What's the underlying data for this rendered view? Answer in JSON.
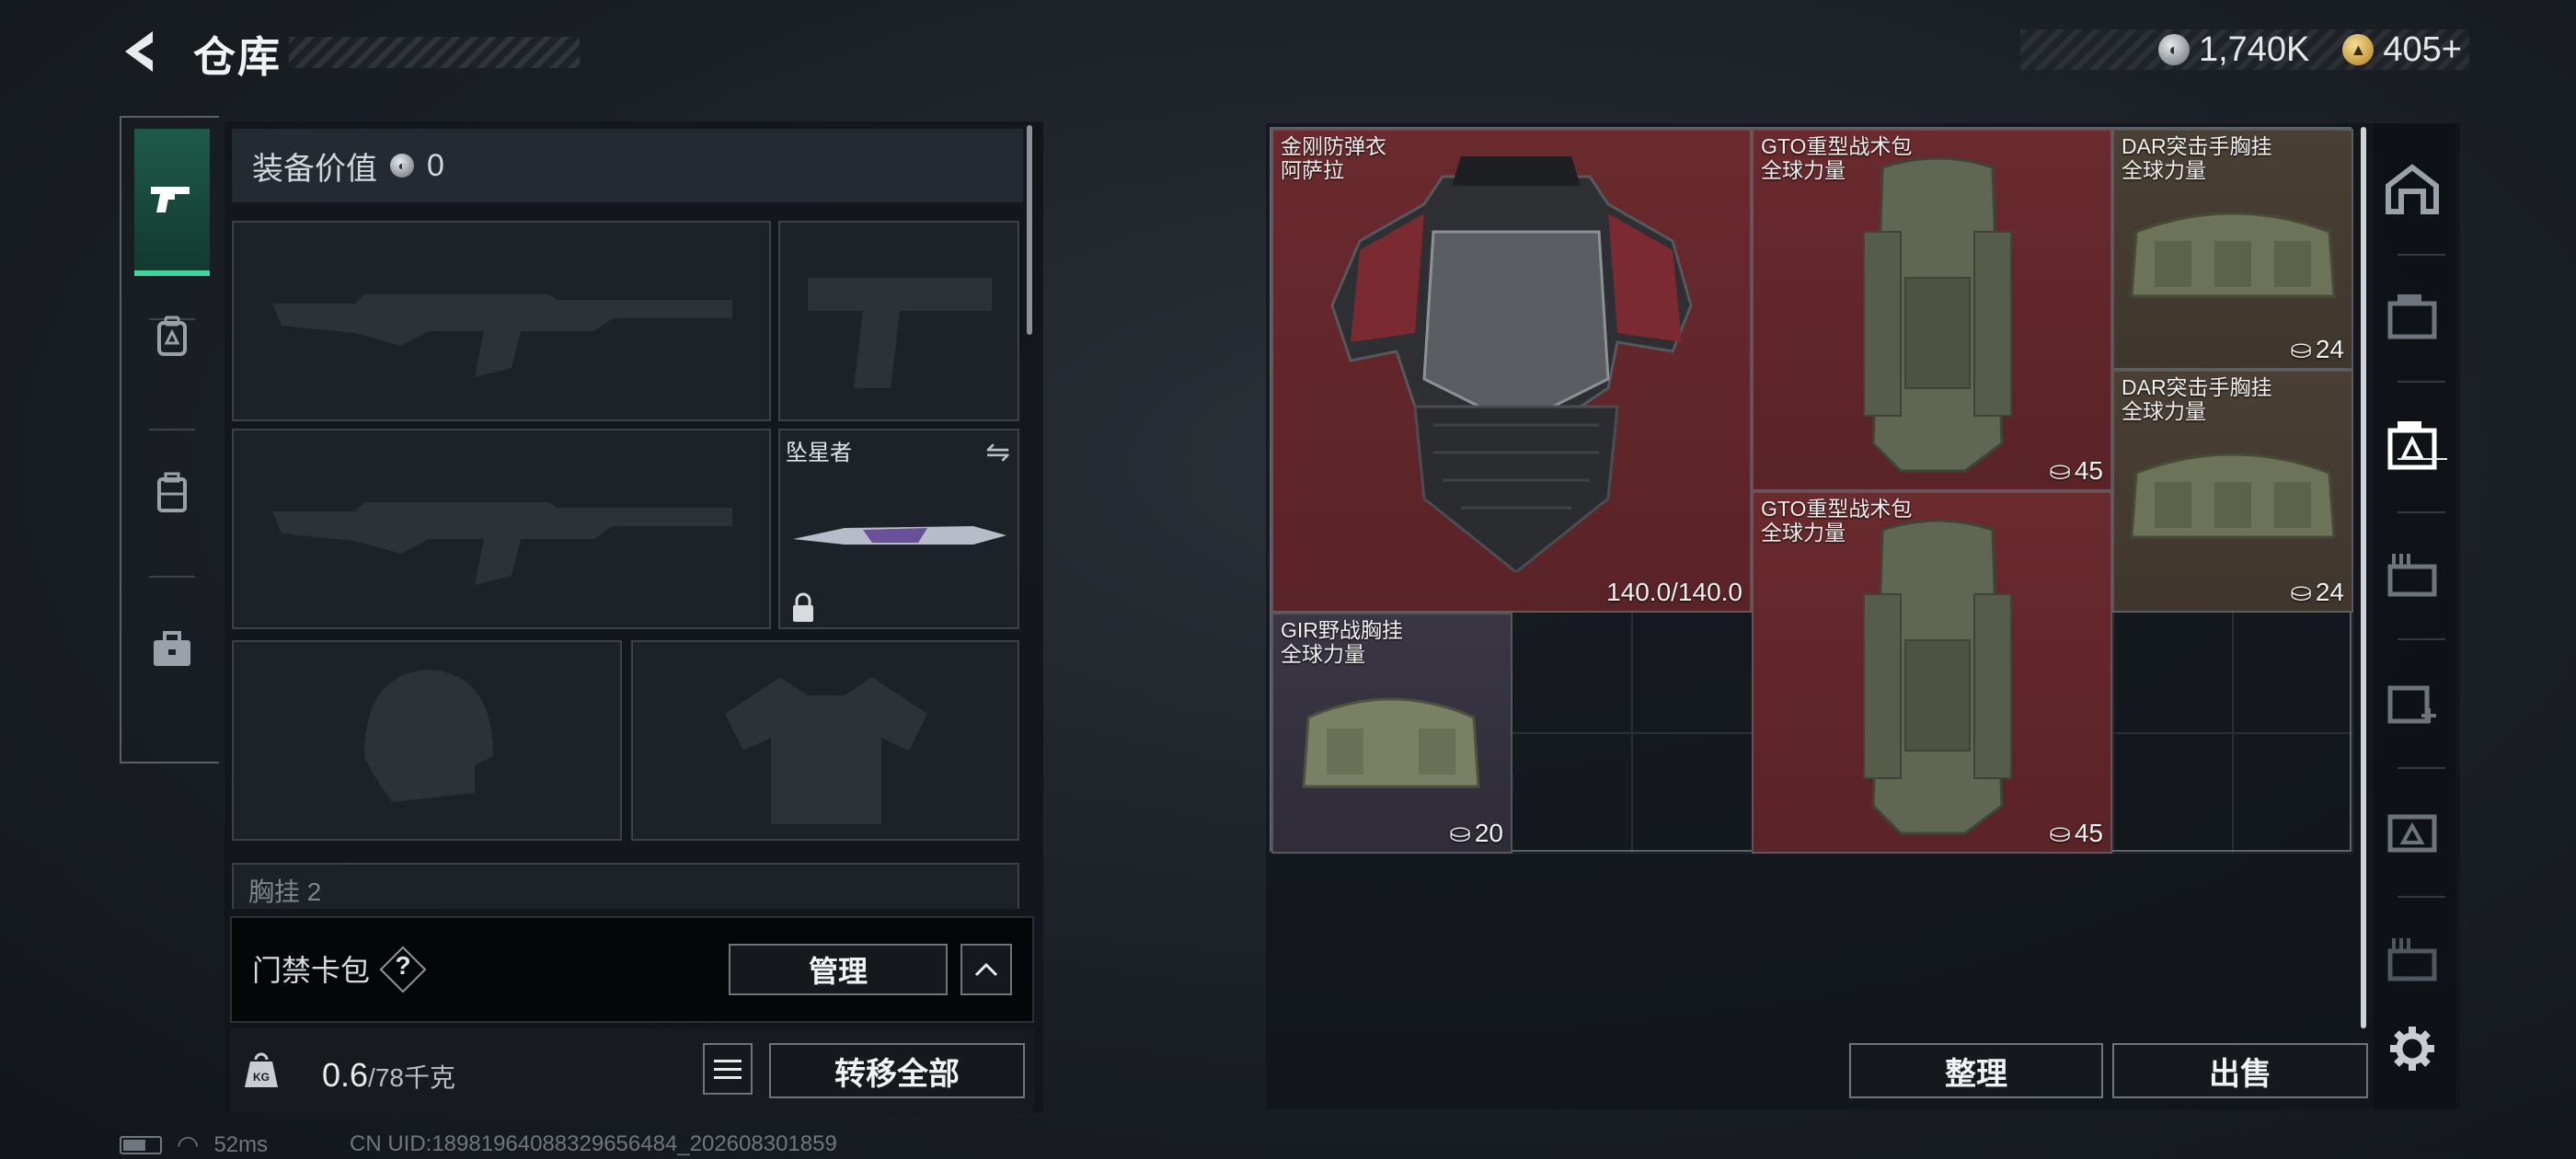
{
  "header": {
    "title": "仓库",
    "back_icon": "back-arrow-icon",
    "currencies": [
      {
        "icon": "silver-coin-icon",
        "value": "1,740K"
      },
      {
        "icon": "gold-coin-icon",
        "value": "405+"
      }
    ]
  },
  "left_tabs": [
    {
      "icon": "pistol-icon",
      "active": true
    },
    {
      "icon": "backpack-icon",
      "active": false
    },
    {
      "icon": "case-icon",
      "active": false
    },
    {
      "icon": "briefcase-icon",
      "active": false
    }
  ],
  "loadout": {
    "equip_value_label": "装备价值",
    "equip_value": "0",
    "melee_slot": {
      "name": "坠星者"
    },
    "faded_section_label": "胸挂 2"
  },
  "access_card": {
    "label": "门禁卡包",
    "help": "?",
    "manage_label": "管理"
  },
  "weight": {
    "current": "0.6",
    "max": "/78千克",
    "transfer_all_label": "转移全部"
  },
  "stash": {
    "items": [
      {
        "name_line1": "金刚防弹衣",
        "name_line2": "阿萨拉",
        "count": "140.0/140.0",
        "count_icon": "",
        "rarity": "red"
      },
      {
        "name_line1": "GTO重型战术包",
        "name_line2": "全球力量",
        "count": "45",
        "count_icon": "capacity-icon",
        "rarity": "red"
      },
      {
        "name_line1": "DAR突击手胸挂",
        "name_line2": "全球力量",
        "count": "24",
        "count_icon": "capacity-icon",
        "rarity": "olive"
      },
      {
        "name_line1": "DAR突击手胸挂",
        "name_line2": "全球力量",
        "count": "24",
        "count_icon": "capacity-icon",
        "rarity": "olive"
      },
      {
        "name_line1": "GTO重型战术包",
        "name_line2": "全球力量",
        "count": "45",
        "count_icon": "capacity-icon",
        "rarity": "red"
      },
      {
        "name_line1": "GIR野战胸挂",
        "name_line2": "全球力量",
        "count": "20",
        "count_icon": "capacity-icon",
        "rarity": "purple"
      }
    ],
    "sort_label": "整理",
    "sell_label": "出售"
  },
  "right_sidebar": [
    {
      "icon": "all-storage-icon"
    },
    {
      "icon": "weapon-storage-icon"
    },
    {
      "icon": "equipment-storage-icon",
      "active": true
    },
    {
      "icon": "ammo-storage-icon"
    },
    {
      "icon": "medical-storage-icon"
    },
    {
      "icon": "gear-storage-icon"
    },
    {
      "icon": "misc-storage-icon"
    },
    {
      "icon": "settings-gear-icon"
    }
  ],
  "status_bar": {
    "ping": "52ms",
    "uid": "CN UID:18981964088329656484_202608301859"
  }
}
